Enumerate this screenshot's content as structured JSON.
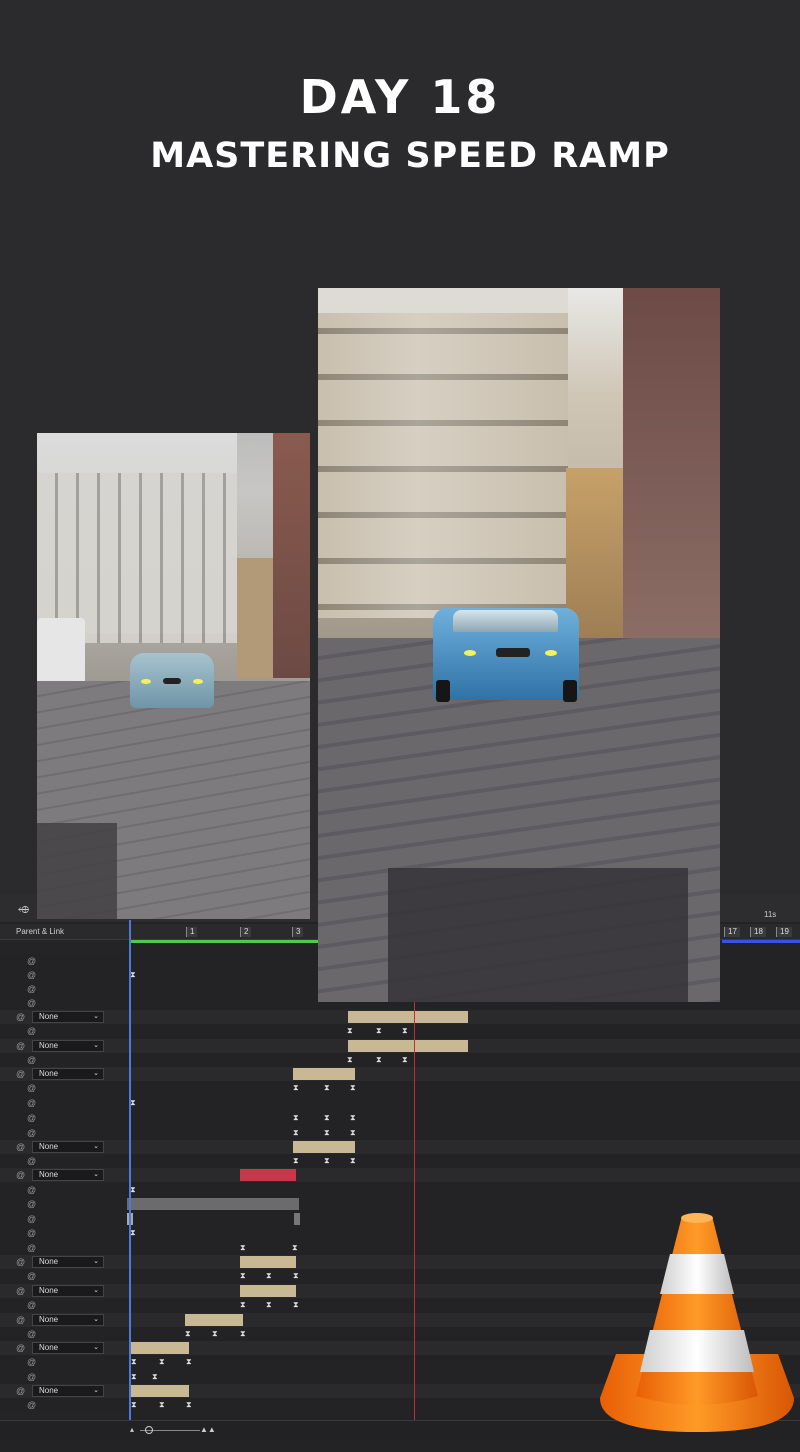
{
  "header": {
    "line1": "DAY 18",
    "line2": "MASTERING SPEED RAMP"
  },
  "timeline": {
    "column_label": "Parent & Link",
    "ruler_markers": [
      "1",
      "2",
      "3",
      "17",
      "18",
      "19"
    ],
    "ruler_time": "11s",
    "parent_value": "None",
    "rows": [
      {
        "sel": false
      },
      {
        "sel": false
      },
      {
        "sel": false
      },
      {
        "sel": false
      },
      {
        "sel": false
      },
      {
        "sel": true
      },
      {
        "sel": false
      },
      {
        "sel": true
      },
      {
        "sel": false
      },
      {
        "sel": true
      },
      {
        "sel": false
      },
      {
        "sel": false
      },
      {
        "sel": false
      },
      {
        "sel": false
      },
      {
        "sel": true
      },
      {
        "sel": false
      },
      {
        "sel": true
      }
    ]
  },
  "colors": {
    "clip_tan": "#c8b893",
    "clip_red": "#c8384b",
    "clip_gray": "#6b6a6d",
    "playhead": "#4b7bd8",
    "current_time": "#b8323a",
    "work_area": "#4ec94e",
    "cone_orange": "#f07a12"
  },
  "icons": {
    "swirl": "@",
    "keyframe": "⧗",
    "chevron": "⌄"
  }
}
